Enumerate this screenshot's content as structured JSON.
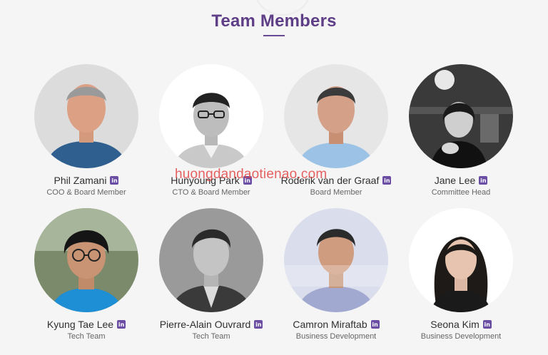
{
  "section_title": "Team Members",
  "watermark": "huongdandaotienao.com",
  "linkedin_glyph": "in",
  "members": [
    {
      "name": "Phil Zamani",
      "role": "COO & Board Member",
      "icon": "linkedin-icon"
    },
    {
      "name": "Hunyoung Park",
      "role": "CTO & Board Member",
      "icon": "linkedin-icon"
    },
    {
      "name": "Roderik van der Graaf",
      "role": "Board Member",
      "icon": "linkedin-icon"
    },
    {
      "name": "Jane Lee",
      "role": "Committee Head",
      "icon": "linkedin-icon"
    },
    {
      "name": "Kyung Tae Lee",
      "role": "Tech Team",
      "icon": "linkedin-icon"
    },
    {
      "name": "Pierre-Alain Ouvrard",
      "role": "Tech Team",
      "icon": "linkedin-icon"
    },
    {
      "name": "Camron Miraftab",
      "role": "Business Development",
      "icon": "linkedin-icon"
    },
    {
      "name": "Seona Kim",
      "role": "Business Development",
      "icon": "linkedin-icon"
    }
  ],
  "colors": {
    "title": "#5e3e86",
    "linkedin": "#6b4ea4",
    "background": "#f5f5f5"
  }
}
